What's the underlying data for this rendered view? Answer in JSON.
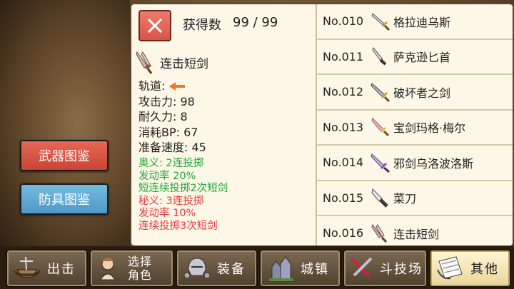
{
  "header": {
    "count_label": "获得数",
    "count_value": "99 / 99"
  },
  "categories": {
    "weapon": "武器图鉴",
    "armor": "防具图鉴"
  },
  "selected": {
    "name": "连击短剑",
    "stats": {
      "trajectory_label": "轨道:",
      "attack": "攻击力: 98",
      "durability": "耐久力: 8",
      "bp_cost": "消耗BP: 67",
      "prep_speed": "准备速度: 45"
    },
    "skills": {
      "ougi_name": "奥义: 2连投掷",
      "ougi_rate": "发动率 20%",
      "ougi_desc": "短连续投掷2次短剑",
      "higi_name": "秘义: 3连投掷",
      "higi_rate": "发动率 10%",
      "higi_desc": "连续投掷3次短剑"
    }
  },
  "weapon_list": [
    {
      "no": "No.010",
      "name": "格拉迪乌斯",
      "icon": "gladius-icon"
    },
    {
      "no": "No.011",
      "name": "萨克逊匕首",
      "icon": "saxon-dagger-icon"
    },
    {
      "no": "No.012",
      "name": "破坏者之剑",
      "icon": "breaker-sword-icon"
    },
    {
      "no": "No.013",
      "name": "宝剑玛格·梅尔",
      "icon": "mag-mell-sword-icon"
    },
    {
      "no": "No.014",
      "name": "邪剑乌洛波洛斯",
      "icon": "ouroboros-sword-icon"
    },
    {
      "no": "No.015",
      "name": "菜刀",
      "icon": "kitchen-knife-icon"
    },
    {
      "no": "No.016",
      "name": "连击短剑",
      "icon": "combo-dagger-icon"
    }
  ],
  "nav": {
    "sortie": "出击",
    "select_line1": "选择",
    "select_line2": "角色",
    "equip": "装备",
    "town": "城镇",
    "arena": "斗技场",
    "other": "其他"
  },
  "colors": {
    "weapon_button": "#d9544a",
    "armor_button": "#5ea7d4",
    "skill_ougi": "#1ea63a",
    "skill_higi": "#e8383a",
    "trajectory_arrow": "#f07820"
  }
}
